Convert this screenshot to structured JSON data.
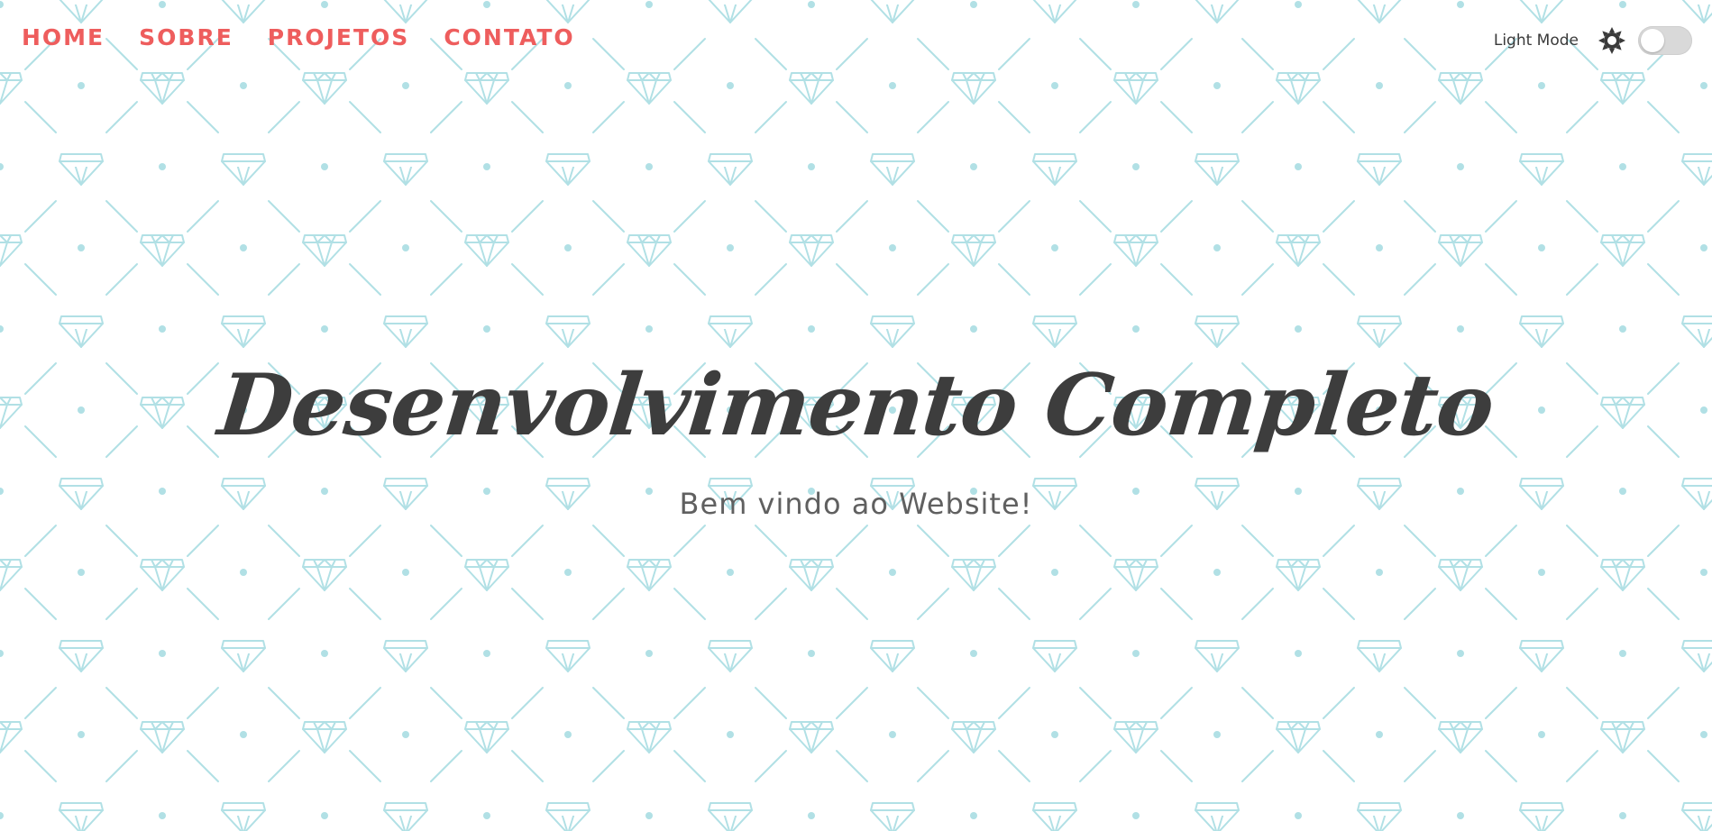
{
  "nav": {
    "items": [
      {
        "label": "HOME"
      },
      {
        "label": "SOBRE"
      },
      {
        "label": "PROJETOS"
      },
      {
        "label": "CONTATO"
      }
    ]
  },
  "theme": {
    "mode_label": "Light Mode",
    "icon": "sun-icon",
    "toggle_on": false
  },
  "hero": {
    "title": "Desenvolvimento Completo",
    "subtitle": "Bem vindo ao Website!"
  },
  "colors": {
    "nav_link": "#ee5d5d",
    "title": "#3d3d3d",
    "subtitle": "#606060",
    "pattern": "#a8dde2",
    "background": "#ffffff"
  }
}
